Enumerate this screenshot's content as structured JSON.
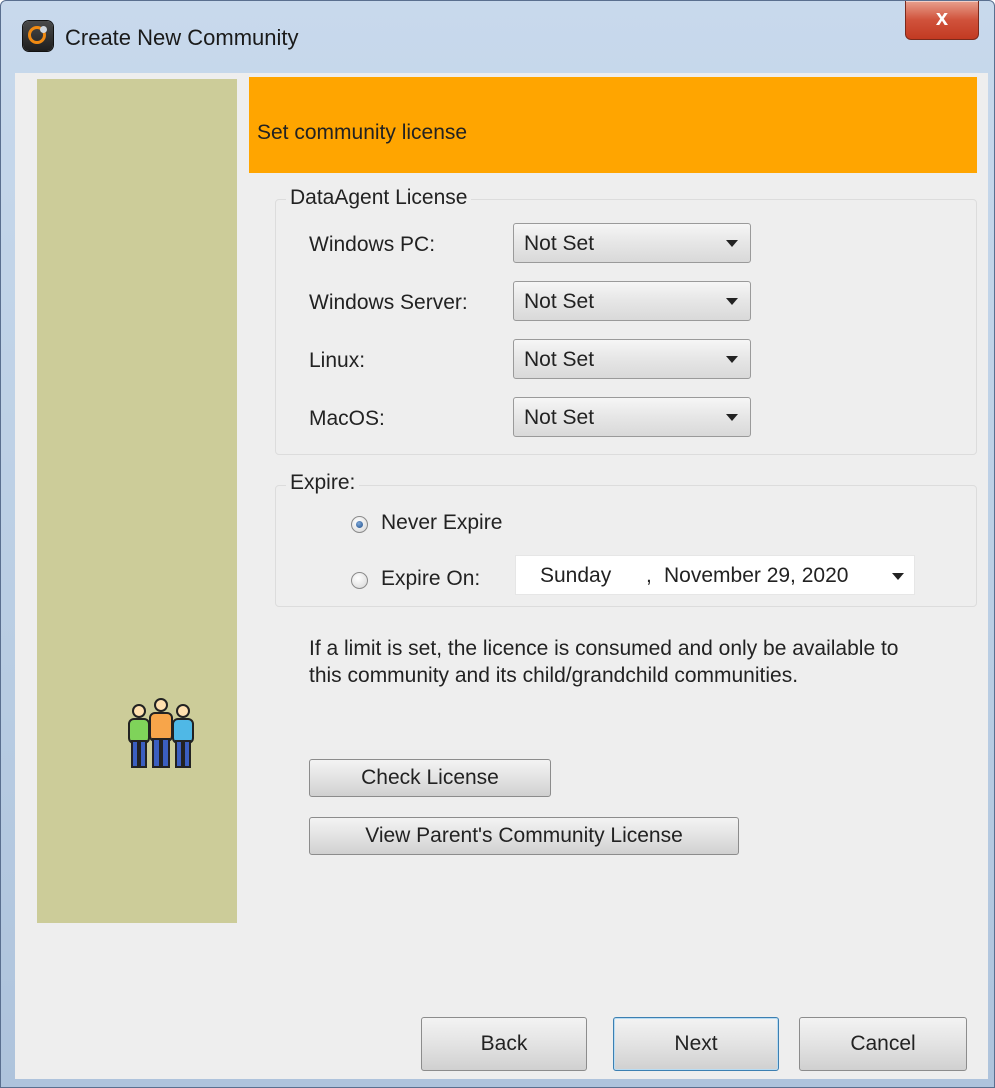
{
  "window": {
    "title": "Create New Community",
    "close_glyph": "x"
  },
  "header": {
    "title": "Set community license"
  },
  "license_group": {
    "legend": "DataAgent License",
    "rows": [
      {
        "label": "Windows PC:",
        "value": "Not Set"
      },
      {
        "label": "Windows Server:",
        "value": "Not Set"
      },
      {
        "label": "Linux:",
        "value": "Not Set"
      },
      {
        "label": "MacOS:",
        "value": "Not Set"
      }
    ]
  },
  "expire_group": {
    "legend": "Expire:",
    "never_label": "Never Expire",
    "on_label": "Expire On:",
    "selected": "never",
    "date": {
      "weekday": "Sunday",
      "separator": ",",
      "rest": "November 29, 2020"
    }
  },
  "info_text": "If a limit is set, the licence is consumed and only be available to this community and its child/grandchild communities.",
  "buttons": {
    "check_license": "Check License",
    "view_parent": "View Parent's Community License",
    "back": "Back",
    "next": "Next",
    "cancel": "Cancel"
  },
  "icons": {
    "app": "app-logo-icon",
    "close": "close-icon",
    "people": "community-people-icon",
    "dropdown": "chevron-down-icon"
  },
  "colors": {
    "banner": "#ffa500",
    "side_panel": "#cccc99",
    "client_bg": "#eeeeee"
  }
}
